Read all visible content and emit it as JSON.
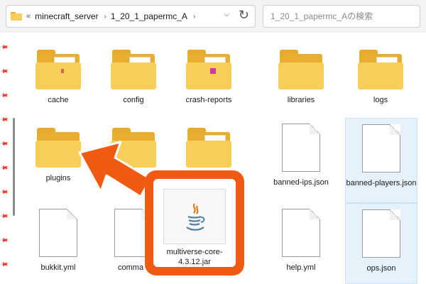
{
  "address_bar": {
    "overflow": "«",
    "path": [
      "minecraft_server",
      "1_20_1_papermc_A"
    ],
    "separator": "›",
    "dropdown": "⌵",
    "refresh": "↻"
  },
  "search": {
    "placeholder": "1_20_1_papermc_Aの検索"
  },
  "items": [
    {
      "label": "cache",
      "type": "folder"
    },
    {
      "label": "config",
      "type": "folder"
    },
    {
      "label": "crash-reports",
      "type": "folder"
    },
    {
      "label": "libraries",
      "type": "folder"
    },
    {
      "label": "logs",
      "type": "folder"
    },
    {
      "label": "plugins",
      "type": "folder"
    },
    {
      "label": "banned-ips.json",
      "type": "file"
    },
    {
      "label": "banned-players.json",
      "type": "file",
      "selected": true
    },
    {
      "label": "bukkit.yml",
      "type": "file"
    },
    {
      "label": "comma",
      "type": "file"
    },
    {
      "label": "help.yml",
      "type": "file"
    },
    {
      "label": "ops.json",
      "type": "file",
      "selected": true
    }
  ],
  "dragged_file": {
    "label": "multiverse-core-4.3.12.jar",
    "icon": "java-icon"
  },
  "colors": {
    "accent": "#f05a12",
    "folder": "#f8ce5a",
    "selection": "#e5f1fb"
  }
}
